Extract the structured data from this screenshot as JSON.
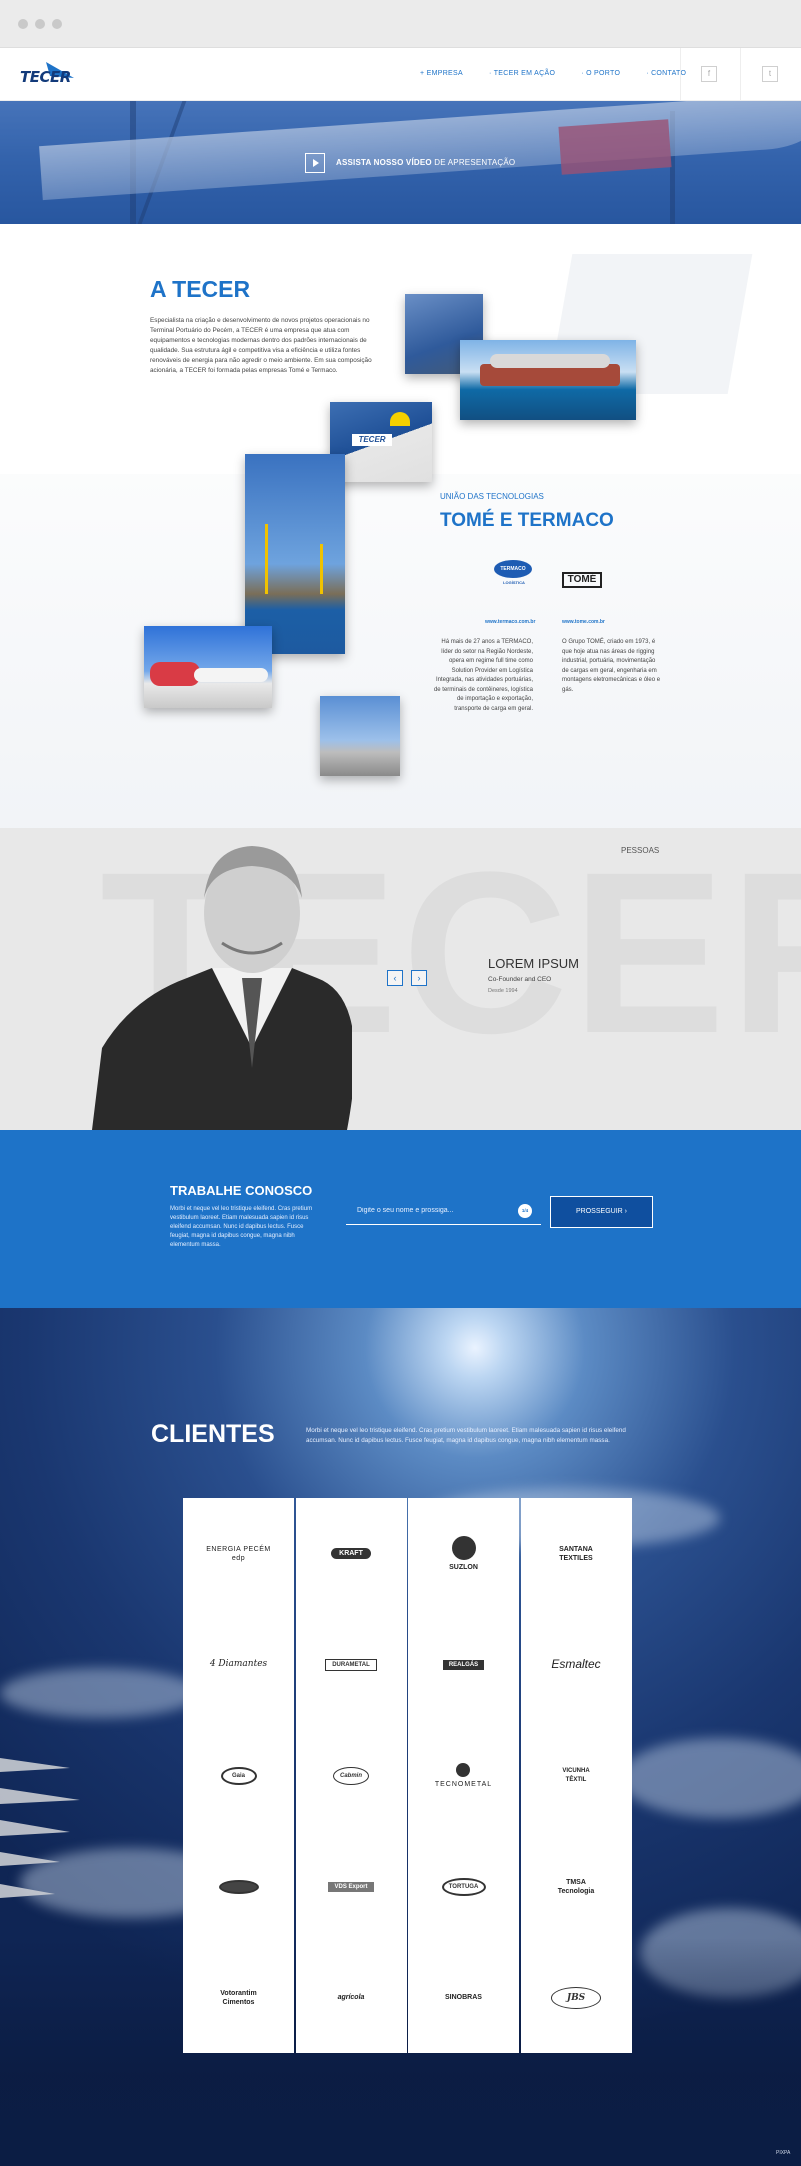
{
  "header": {
    "logo_text": "TECER",
    "nav": [
      "+ EMPRESA",
      "· TECER EM AÇÃO",
      "· O PORTO",
      "· CONTATO"
    ],
    "social": [
      {
        "icon": "facebook-icon",
        "glyph": "f"
      },
      {
        "icon": "twitter-icon",
        "glyph": "t"
      }
    ]
  },
  "hero": {
    "cta_bold": "ASSISTA NOSSO VÍDEO",
    "cta_rest": " DE APRESENTAÇÃO"
  },
  "about": {
    "title": "A TECER",
    "body": "Especialista na criação e desenvolvimento de novos projetos operacionais no Terminal Portuário do Pecém, a TECER é uma empresa que atua com equipamentos e tecnologias modernas dentro dos padrões internacionais de qualidade. Sua estrutura ágil e competitiva visa a eficiência e utiliza fontes renováveis de energia para não agredir o meio ambiente. Em sua composição acionária, a TECER foi formada pelas empresas Tomé e Termaco.",
    "union_label": "UNIÃO DAS TECNOLOGIAS",
    "union_title": "TOMÉ E TERMACO",
    "termaco": {
      "logo_text": "TERMACO",
      "logo_sub": "LOGÍSTICA",
      "url": "www.termaco.com.br",
      "text": "Há mais de 27 anos a TERMACO, líder do setor na Região Nordeste, opera em regime full time como Solution Provider em Logística Integrada, nas atividades portuárias, de terminais de contêineres, logística de importação e exportação, transporte de carga em geral."
    },
    "tome": {
      "logo_text": "TOMÉ",
      "url": "www.tome.com.br",
      "text": "O Grupo TOMÉ, criado em 1973, é que hoje atua nas áreas de rigging industrial, portuária, movimentação de cargas em geral, engenharia em montagens eletromecânicas e óleo e gás."
    }
  },
  "people": {
    "bg_text": "TECER",
    "section_label": "PESSOAS",
    "name": "LOREM IPSUM",
    "role": "Co-Founder and CEO",
    "since": "Desde 1994",
    "prev": "‹",
    "next": "›"
  },
  "work": {
    "title": "TRABALHE CONOSCO",
    "text": "Morbi et neque vel leo tristique eleifend. Cras pretium vestibulum laoreet. Etiam malesuada sapien id risus eleifend accumsan. Nunc id dapibus lectus. Fusce feugiat, magna id dapibus congue, magna nibh elementum massa.",
    "placeholder": "Digite o seu nome e prossiga...",
    "badge": "1/4",
    "button": "PROSSEGUIR  ›"
  },
  "clients": {
    "title": "CLIENTES",
    "text": "Morbi et neque vel leo tristique eleifend. Cras pretium vestibulum laoreet. Etiam malesuada sapien id risus eleifend accumsan. Nunc id dapibus lectus. Fusce feugiat, magna id dapibus congue, magna nibh elementum massa.",
    "columns": [
      [
        "ENERGIA PECÉM\nedp",
        "4 Diamantes",
        "Gaia",
        "",
        "Votorantim\nCimentos"
      ],
      [
        "KRAFT",
        "DURAMETAL",
        "Cabmin",
        "VDS Export",
        "agrícola"
      ],
      [
        "SUZLON",
        "REALGÁS",
        "TECNOMETAL",
        "TORTUGA",
        "SINOBRAS"
      ],
      [
        "SANTANA\nTEXTILES",
        "Esmaltec",
        "VICUNHA\nTÊXTIL",
        "TMSA\nTecnologia",
        "JBS"
      ]
    ],
    "footer_mark": "PIXPA"
  }
}
